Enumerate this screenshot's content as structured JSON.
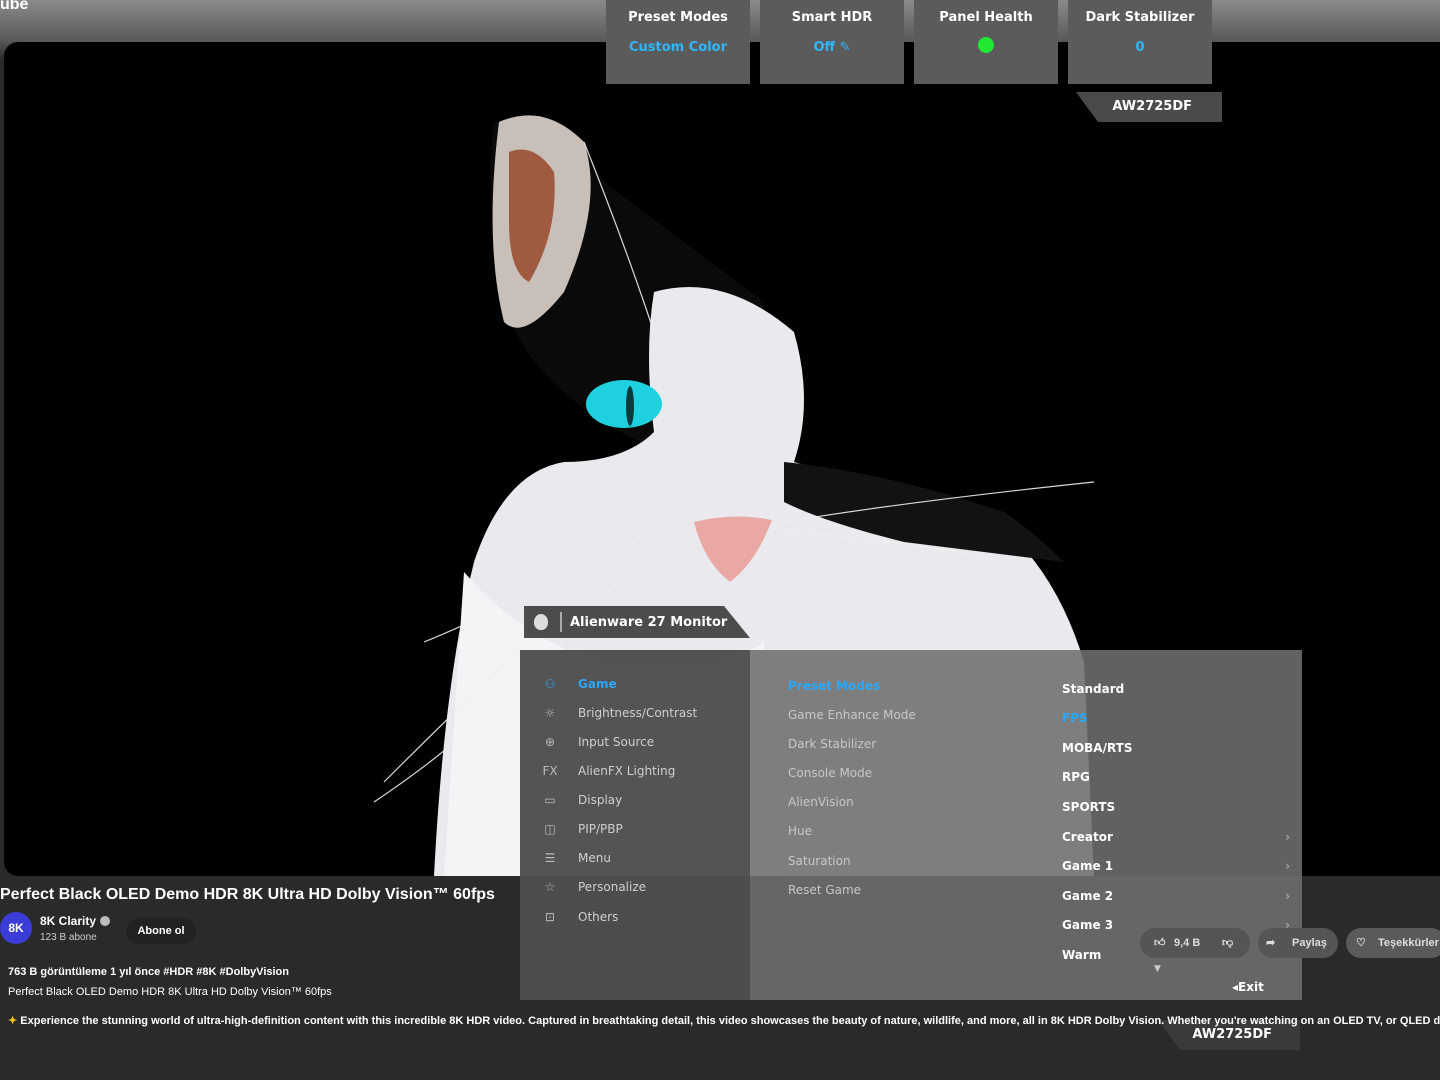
{
  "youtube": {
    "logo_text": "ube",
    "video_title": "Perfect Black OLED Demo HDR 8K Ultra HD Dolby Vision™ 60fps",
    "channel_name": "8K Clarity",
    "channel_avatar": "8K",
    "subscribers": "123 B abone",
    "subscribe_label": "Abone ol",
    "views_line": "763 B görüntüleme  1 yıl önce  #HDR #8K #DolbyVision",
    "description_title": "Perfect Black OLED Demo HDR 8K Ultra HD Dolby Vision™ 60fps",
    "description": "Experience the stunning world of ultra-high-definition content with this incredible 8K HDR video. Captured in breathtaking detail, this video showcases the beauty of nature, wildlife, and more, all in 8K HDR Dolby Vision. Whether you're watching on an OLED TV, or QLED display, or ...daha",
    "like_count": "9,4 B",
    "share_label": "Paylaş",
    "thanks_label": "Teşekkürler"
  },
  "quick_bar": [
    {
      "title": "Preset Modes",
      "value": "Custom Color"
    },
    {
      "title": "Smart HDR",
      "value": "Off"
    },
    {
      "title": "Panel Health",
      "value": ""
    },
    {
      "title": "Dark Stabilizer",
      "value": "0"
    }
  ],
  "model": "AW2725DF",
  "osd": {
    "title": "Alienware 27 Monitor",
    "menu": [
      {
        "label": "Game",
        "icon": "gamepad-icon",
        "glyph": "⚇"
      },
      {
        "label": "Brightness/Contrast",
        "icon": "sun-icon",
        "glyph": "☼"
      },
      {
        "label": "Input Source",
        "icon": "input-icon",
        "glyph": "⊕"
      },
      {
        "label": "AlienFX Lighting",
        "icon": "fx-icon",
        "glyph": "FX"
      },
      {
        "label": "Display",
        "icon": "display-icon",
        "glyph": "▭"
      },
      {
        "label": "PIP/PBP",
        "icon": "pip-icon",
        "glyph": "◫"
      },
      {
        "label": "Menu",
        "icon": "menu-icon",
        "glyph": "☰"
      },
      {
        "label": "Personalize",
        "icon": "star-icon",
        "glyph": "☆"
      },
      {
        "label": "Others",
        "icon": "others-icon",
        "glyph": "⊡"
      }
    ],
    "submenu": [
      "Preset Modes",
      "Game Enhance Mode",
      "Dark Stabilizer",
      "Console Mode",
      "AlienVision",
      "Hue",
      "Saturation",
      "Reset Game"
    ],
    "options": [
      "Standard",
      "FPS",
      "MOBA/RTS",
      "RPG",
      "SPORTS",
      "Creator",
      "Game 1",
      "Game 2",
      "Game 3",
      "Warm"
    ],
    "exit_label": "Exit",
    "colors": {
      "accent": "#2aa8ff",
      "health": "#22e833"
    }
  }
}
